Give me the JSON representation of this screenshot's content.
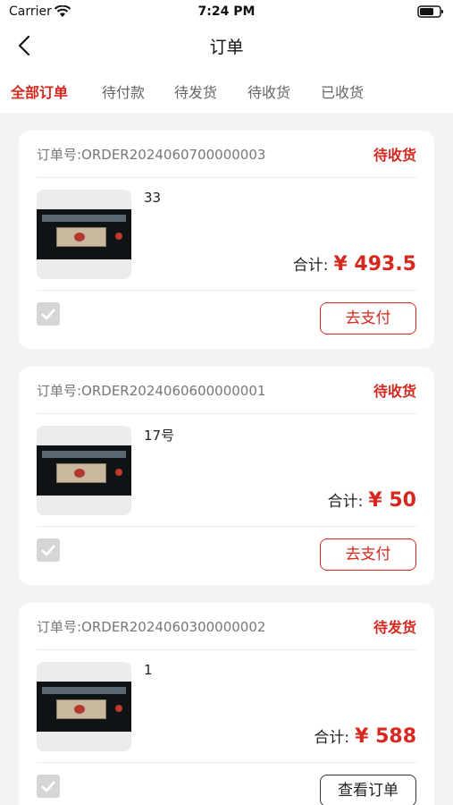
{
  "status_bar": {
    "carrier": "Carrier",
    "time": "7:24 PM"
  },
  "nav": {
    "title": "订单"
  },
  "tabs": [
    {
      "label": "全部订单",
      "active": true
    },
    {
      "label": "待付款",
      "active": false
    },
    {
      "label": "待发货",
      "active": false
    },
    {
      "label": "待收货",
      "active": false
    },
    {
      "label": "已收货",
      "active": false
    }
  ],
  "orders": [
    {
      "order_no": "订单号:ORDER2024060700000003",
      "status": "待收货",
      "item_name": "33",
      "total_label": "合计:",
      "total_amount": "¥ 493.5",
      "action": "去支付"
    },
    {
      "order_no": "订单号:ORDER2024060600000001",
      "status": "待收货",
      "item_name": "17号",
      "total_label": "合计:",
      "total_amount": "¥ 50",
      "action": "去支付"
    },
    {
      "order_no": "订单号:ORDER2024060300000002",
      "status": "待发货",
      "item_name": "1",
      "total_label": "合计:",
      "total_amount": "¥ 588",
      "action": "查看订单"
    }
  ],
  "colors": {
    "accent": "#d6281e",
    "background": "#f3f3f3"
  }
}
